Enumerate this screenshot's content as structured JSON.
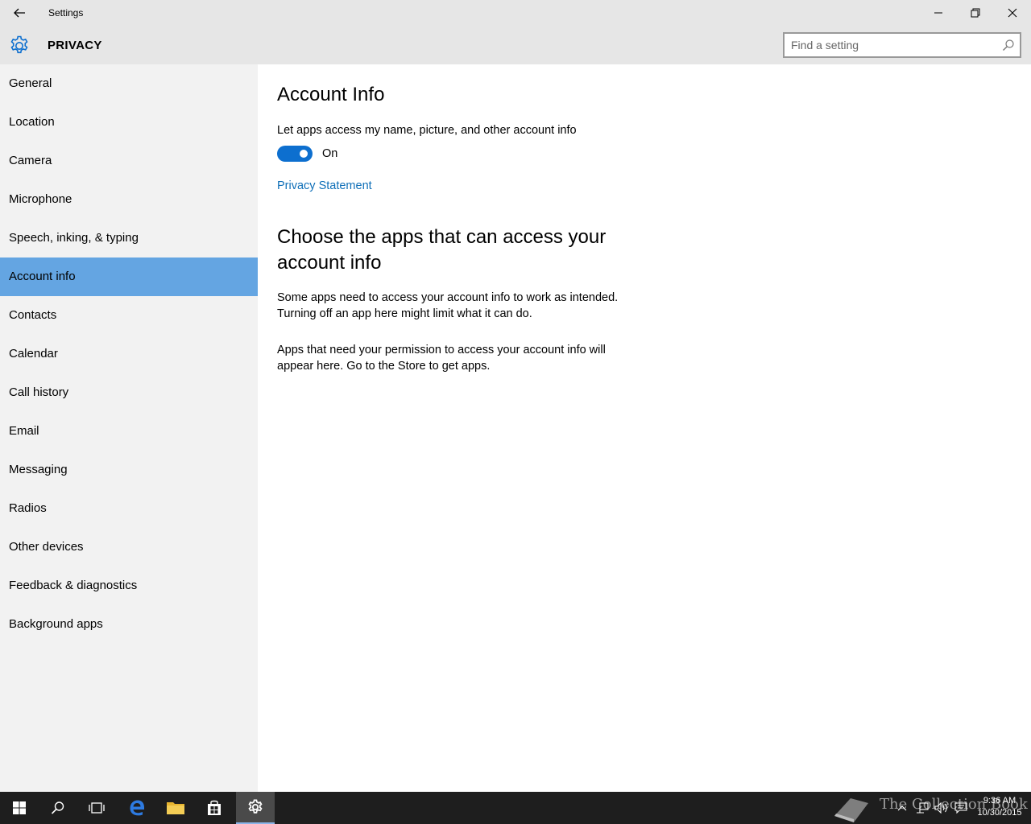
{
  "window": {
    "title": "Settings",
    "section": "PRIVACY"
  },
  "search": {
    "placeholder": "Find a setting"
  },
  "sidebar": {
    "items": [
      {
        "label": "General"
      },
      {
        "label": "Location"
      },
      {
        "label": "Camera"
      },
      {
        "label": "Microphone"
      },
      {
        "label": "Speech, inking, & typing"
      },
      {
        "label": "Account info",
        "selected": true
      },
      {
        "label": "Contacts"
      },
      {
        "label": "Calendar"
      },
      {
        "label": "Call history"
      },
      {
        "label": "Email"
      },
      {
        "label": "Messaging"
      },
      {
        "label": "Radios"
      },
      {
        "label": "Other devices"
      },
      {
        "label": "Feedback & diagnostics"
      },
      {
        "label": "Background apps"
      }
    ]
  },
  "main": {
    "heading": "Account Info",
    "toggle_label": "Let apps access my name, picture, and other account info",
    "toggle_state": "On",
    "toggle_on": true,
    "privacy_link": "Privacy Statement",
    "section_heading": "Choose the apps that can access your account info",
    "paragraph1": "Some apps need to access your account info to work as intended. Turning off an app here might limit what it can do.",
    "paragraph2": "Apps that need your permission to access your account info will appear here. Go to the Store to get apps."
  },
  "taskbar": {
    "watermark": "The Collection Book",
    "time": "9:36 AM",
    "date": "10/30/2015"
  },
  "colors": {
    "accent": "#0d6fcf",
    "selected_nav": "#64a5e2",
    "link": "#0f6fb8"
  },
  "icons": {
    "back": "back-arrow-icon",
    "gear": "gear-icon",
    "search": "search-icon",
    "minimize": "minimize-icon",
    "maximize": "restore-icon",
    "close": "close-icon"
  }
}
